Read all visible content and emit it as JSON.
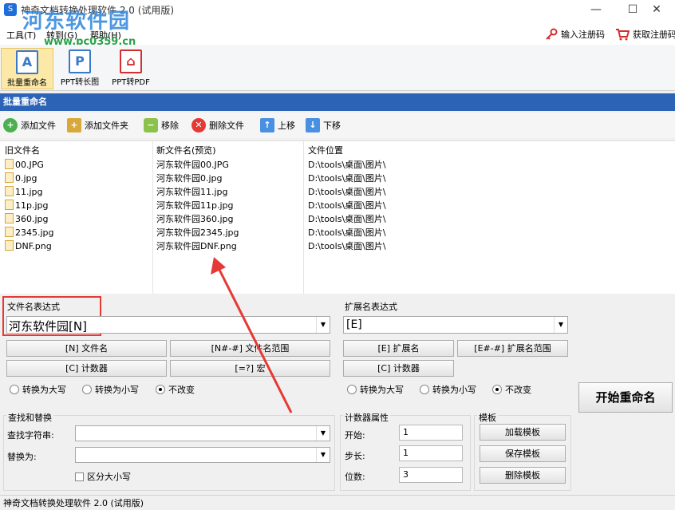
{
  "window": {
    "title": "神奇文档转换处理软件 2.0 (试用版)",
    "min": "—",
    "max": "☐",
    "close": "✕"
  },
  "watermark": {
    "text": "河东软件园",
    "url": "www.pc0359.cn"
  },
  "menu": {
    "items": [
      "工具(T)",
      "转到(G)",
      "帮助(H)"
    ],
    "register_label": "输入注册码",
    "get_code_label": "获取注册码"
  },
  "ribbon": {
    "items": [
      {
        "label": "批量重命名",
        "icon_char": "A"
      },
      {
        "label": "PPT转长图",
        "icon_char": "P"
      },
      {
        "label": "PPT转PDF",
        "icon_char": "⌂"
      }
    ]
  },
  "section_title": "批量重命名",
  "toolbar": {
    "add_file": "添加文件",
    "add_folder": "添加文件夹",
    "remove": "移除",
    "delete_file": "删除文件",
    "move_up": "上移",
    "move_down": "下移"
  },
  "grid": {
    "headers": [
      "旧文件名",
      "新文件名(预览)",
      "文件位置"
    ],
    "rows": [
      [
        "00.JPG",
        "河东软件园00.JPG",
        "D:\\tools\\桌面\\图片\\"
      ],
      [
        "0.jpg",
        "河东软件园0.jpg",
        "D:\\tools\\桌面\\图片\\"
      ],
      [
        "11.jpg",
        "河东软件园11.jpg",
        "D:\\tools\\桌面\\图片\\"
      ],
      [
        "11p.jpg",
        "河东软件园11p.jpg",
        "D:\\tools\\桌面\\图片\\"
      ],
      [
        "360.jpg",
        "河东软件园360.jpg",
        "D:\\tools\\桌面\\图片\\"
      ],
      [
        "2345.jpg",
        "河东软件园2345.jpg",
        "D:\\tools\\桌面\\图片\\"
      ],
      [
        "DNF.png",
        "河东软件园DNF.png",
        "D:\\tools\\桌面\\图片\\"
      ]
    ]
  },
  "filename_expr": {
    "label": "文件名表达式",
    "value": "河东软件园[N]",
    "btn_name": "[N] 文件名",
    "btn_name_range": "[N#-#] 文件名范围",
    "btn_counter": "[C] 计数器",
    "btn_macro": "[=?] 宏",
    "radio_upper": "转换为大写",
    "radio_lower": "转换为小写",
    "radio_keep": "不改变"
  },
  "ext_expr": {
    "label": "扩展名表达式",
    "value": "[E]",
    "btn_ext": "[E] 扩展名",
    "btn_ext_range": "[E#-#] 扩展名范围",
    "btn_counter": "[C] 计数器",
    "radio_upper": "转换为大写",
    "radio_lower": "转换为小写",
    "radio_keep": "不改变"
  },
  "start_button": "开始重命名",
  "find_replace": {
    "title": "查找和替换",
    "find_label": "查找字符串:",
    "replace_label": "替换为:",
    "case_label": "区分大小写",
    "find_value": "",
    "replace_value": ""
  },
  "counter": {
    "title": "计数器属性",
    "start_label": "开始:",
    "start_value": "1",
    "step_label": "步长:",
    "step_value": "1",
    "digits_label": "位数:",
    "digits_value": "3"
  },
  "template": {
    "title": "模板",
    "load": "加载模板",
    "save": "保存模板",
    "delete": "删除模板"
  },
  "status": "神奇文档转换处理软件 2.0 (试用版)",
  "colors": {
    "section_bar": "#2c63b7",
    "highlight_box": "#e53935",
    "arrow": "#e53935"
  }
}
